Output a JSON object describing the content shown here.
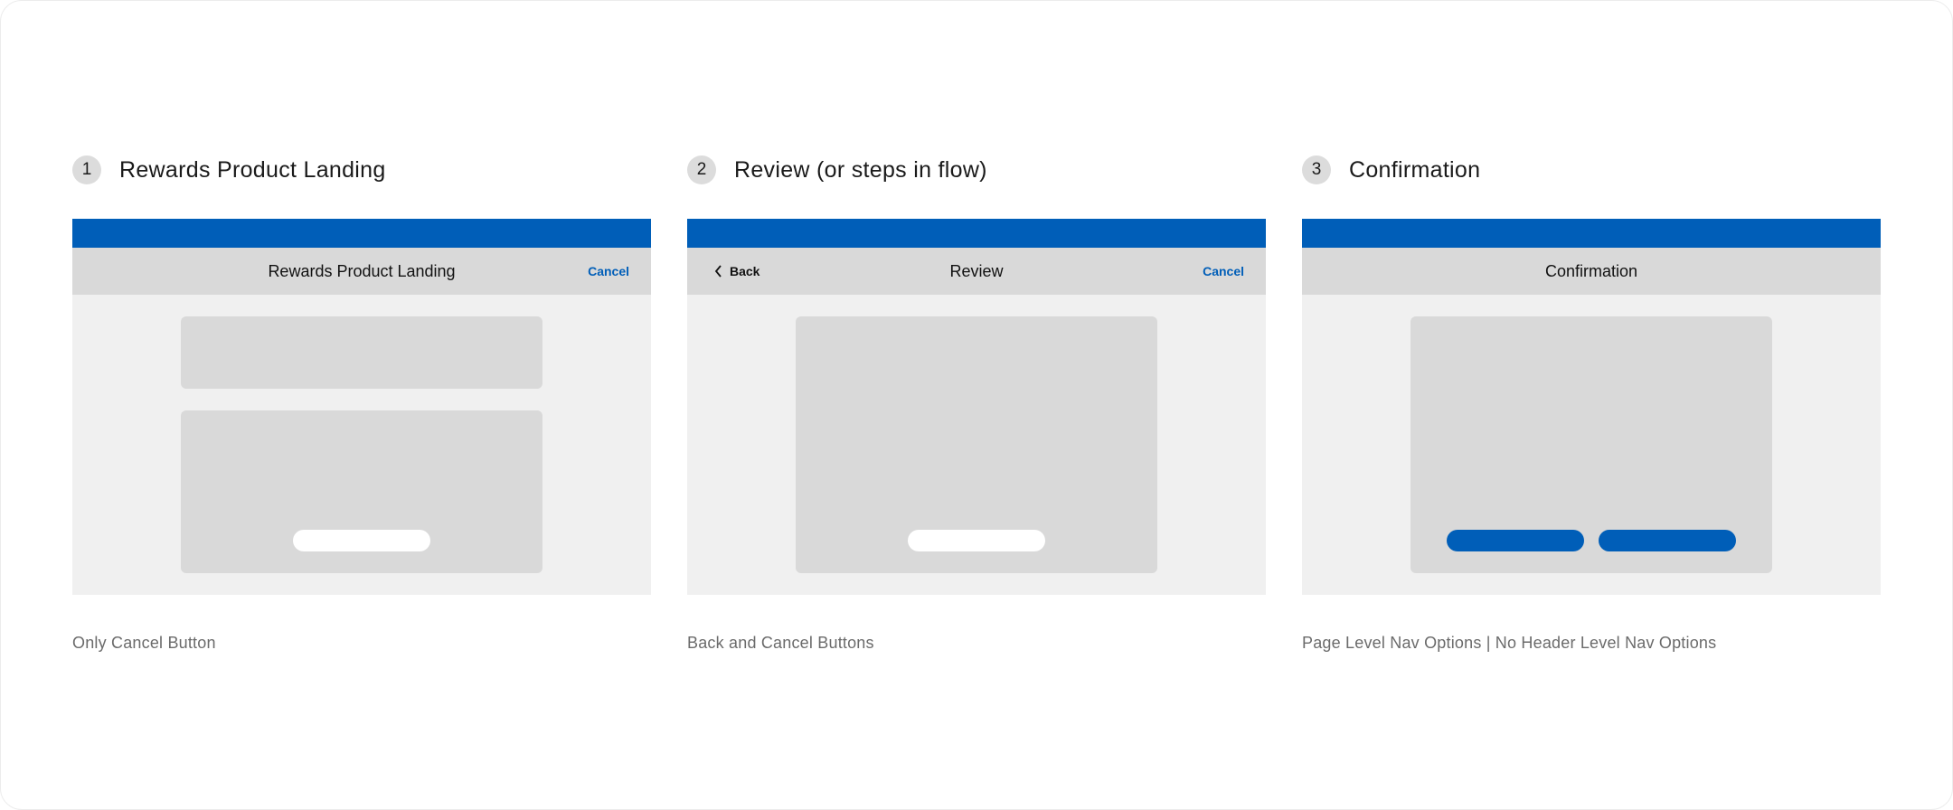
{
  "steps": [
    {
      "number": "1",
      "title": "Rewards Product Landing",
      "nav_title": "Rewards Product Landing",
      "cancel_label": "Cancel",
      "caption": "Only Cancel Button"
    },
    {
      "number": "2",
      "title": "Review (or steps in flow)",
      "nav_title": "Review",
      "back_label": "Back",
      "cancel_label": "Cancel",
      "caption": "Back and Cancel Buttons"
    },
    {
      "number": "3",
      "title": "Confirmation",
      "nav_title": "Confirmation",
      "caption": "Page Level Nav Options | No Header Level Nav Options"
    }
  ],
  "colors": {
    "brand_blue": "#005eb8",
    "placeholder_gray": "#d9d9d9",
    "frame_background": "#f0f0f0"
  },
  "icons": {
    "back": "chevron-left-icon"
  }
}
